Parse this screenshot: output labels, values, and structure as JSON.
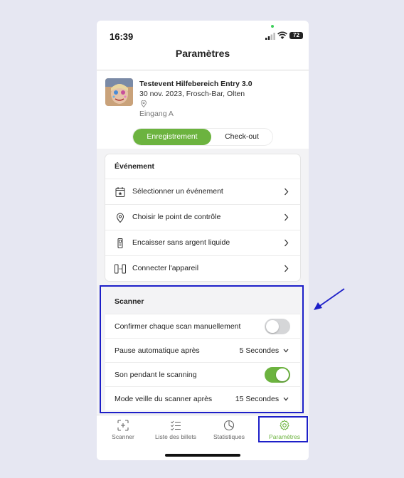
{
  "status_bar": {
    "time": "16:39",
    "battery": "72"
  },
  "header": {
    "title": "Paramètres"
  },
  "event": {
    "name": "Testevent Hilfebereich Entry 3.0",
    "date_location": "30 nov. 2023, Frosch-Bar, Olten",
    "entrance": "Eingang A"
  },
  "mode_toggle": {
    "options": [
      "Enregistrement",
      "Check-out"
    ],
    "selected": "Enregistrement"
  },
  "event_section": {
    "title": "Événement",
    "items": [
      {
        "label": "Sélectionner un événement",
        "icon": "calendar-star-icon"
      },
      {
        "label": "Choisir le point de contrôle",
        "icon": "location-pin-icon"
      },
      {
        "label": "Encaisser sans argent liquide",
        "icon": "card-terminal-icon"
      },
      {
        "label": "Connecter l'appareil",
        "icon": "device-connect-icon"
      }
    ]
  },
  "scanner_section": {
    "title": "Scanner",
    "items": [
      {
        "label": "Confirmer chaque scan manuellement",
        "type": "toggle",
        "on": false
      },
      {
        "label": "Pause automatique après",
        "type": "select",
        "value": "5 Secondes"
      },
      {
        "label": "Son pendant le scanning",
        "type": "toggle",
        "on": true
      },
      {
        "label": "Mode veille du scanner après",
        "type": "select",
        "value": "15 Secondes"
      }
    ]
  },
  "tabbar": {
    "tabs": [
      {
        "label": "Scanner",
        "icon": "scan-icon"
      },
      {
        "label": "Liste des billets",
        "icon": "checklist-icon"
      },
      {
        "label": "Statistiques",
        "icon": "pie-chart-icon"
      },
      {
        "label": "Paramètres",
        "icon": "gear-icon",
        "active": true
      }
    ]
  },
  "colors": {
    "accent": "#6cb33f",
    "highlight": "#1d1fc8",
    "background": "#e6e7f2"
  }
}
